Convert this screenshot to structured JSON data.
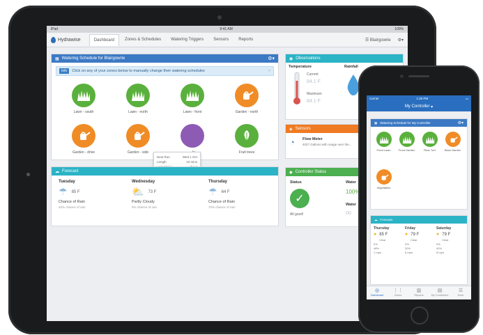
{
  "ipad": {
    "statusbar": {
      "left": "iPad",
      "time": "9:41 AM",
      "battery": "100%"
    },
    "brand": "Hydrawise",
    "nav": [
      "Dashboard",
      "Zones & Schedules",
      "Watering Triggers",
      "Sensors",
      "Reports"
    ],
    "nav_active": "Dashboard",
    "controller_name": "Blairgowrie",
    "schedule": {
      "title": "Watering Schedule for Blairgowrie",
      "info_tag": "Info",
      "info_text": "Click on any of your zones below to manually change their watering schedules",
      "zones": [
        {
          "label": "Lawn - south",
          "type": "grass"
        },
        {
          "label": "Lawn - north",
          "type": "grass"
        },
        {
          "label": "Lawn - front",
          "type": "grass"
        },
        {
          "label": "Garden - north",
          "type": "can"
        },
        {
          "label": "Garden - drive",
          "type": "can"
        },
        {
          "label": "Garden - side",
          "type": "can"
        },
        {
          "label": "...ls",
          "type": "can"
        },
        {
          "label": "Fruit trees",
          "type": "leaf"
        }
      ],
      "popup": {
        "rows": [
          [
            "Next Run",
            "Wed 1 Oct"
          ],
          [
            "Length",
            "10 mins"
          ],
          [
            "Last Water",
            "about"
          ]
        ]
      }
    },
    "forecast": {
      "title": "Forecast",
      "days": [
        {
          "day": "Tuesday",
          "temp": "85 F",
          "cond": "Chance of Rain",
          "sub": "40% chance of rain"
        },
        {
          "day": "Wednesday",
          "temp": "73 F",
          "cond": "Partly Cloudy",
          "sub": "0% chance of rain"
        },
        {
          "day": "Thursday",
          "temp": "64 F",
          "cond": "Chance of Rain",
          "sub": "70% chance of rain"
        }
      ]
    },
    "observations": {
      "title": "Observations",
      "temperature_label": "Temperature",
      "rainfall_label": "Rainfall",
      "current_label": "Current",
      "current_value": "84.1 F",
      "maximum_label": "Maximum",
      "maximum_value": "84.1 F"
    },
    "sensors": {
      "title": "Sensors",
      "name": "Flow Meter",
      "desc": "4027 Gallons with usage over the..."
    },
    "status": {
      "title": "Controller Status",
      "status_label": "Status",
      "status_value": "All good!",
      "water_label": "Water",
      "water_value": "100%",
      "water2_label": "Water",
      "water2_value": "00"
    }
  },
  "iphone": {
    "status": {
      "carrier": "Carrier",
      "time": "1:26 PM"
    },
    "title": "My Controller",
    "schedule_title": "Watering Schedule for My Controller",
    "zones": [
      {
        "label": "Front Lawn",
        "type": "grass"
      },
      {
        "label": "Front Garden",
        "type": "grass"
      },
      {
        "label": "Rear Turf",
        "type": "grass"
      },
      {
        "label": "Back Garden",
        "type": "can"
      },
      {
        "label": "Vegetables",
        "type": "can"
      }
    ],
    "forecast_title": "Forecast",
    "forecast": [
      {
        "day": "Thursday",
        "temp": "85 F",
        "cond": "Clear",
        "lines": [
          "0%",
          "48%",
          "1 mph"
        ]
      },
      {
        "day": "Friday",
        "temp": "79 F",
        "cond": "Clear",
        "lines": [
          "0%",
          "30%",
          "6 mph"
        ]
      },
      {
        "day": "Saturday",
        "temp": "79 F",
        "cond": "Clear",
        "lines": [
          "0%",
          "40%",
          "8 mph"
        ]
      }
    ],
    "tabs": [
      "Dashboard",
      "Zones",
      "Reports",
      "My Controllers",
      "More"
    ]
  },
  "colors": {
    "blue_header": "#3c79c4",
    "teal_header": "#2bb3c6",
    "orange_header": "#ef7b22",
    "green_header": "#4caf50",
    "zone_green": "#5ab03c",
    "zone_orange": "#f08c26"
  }
}
